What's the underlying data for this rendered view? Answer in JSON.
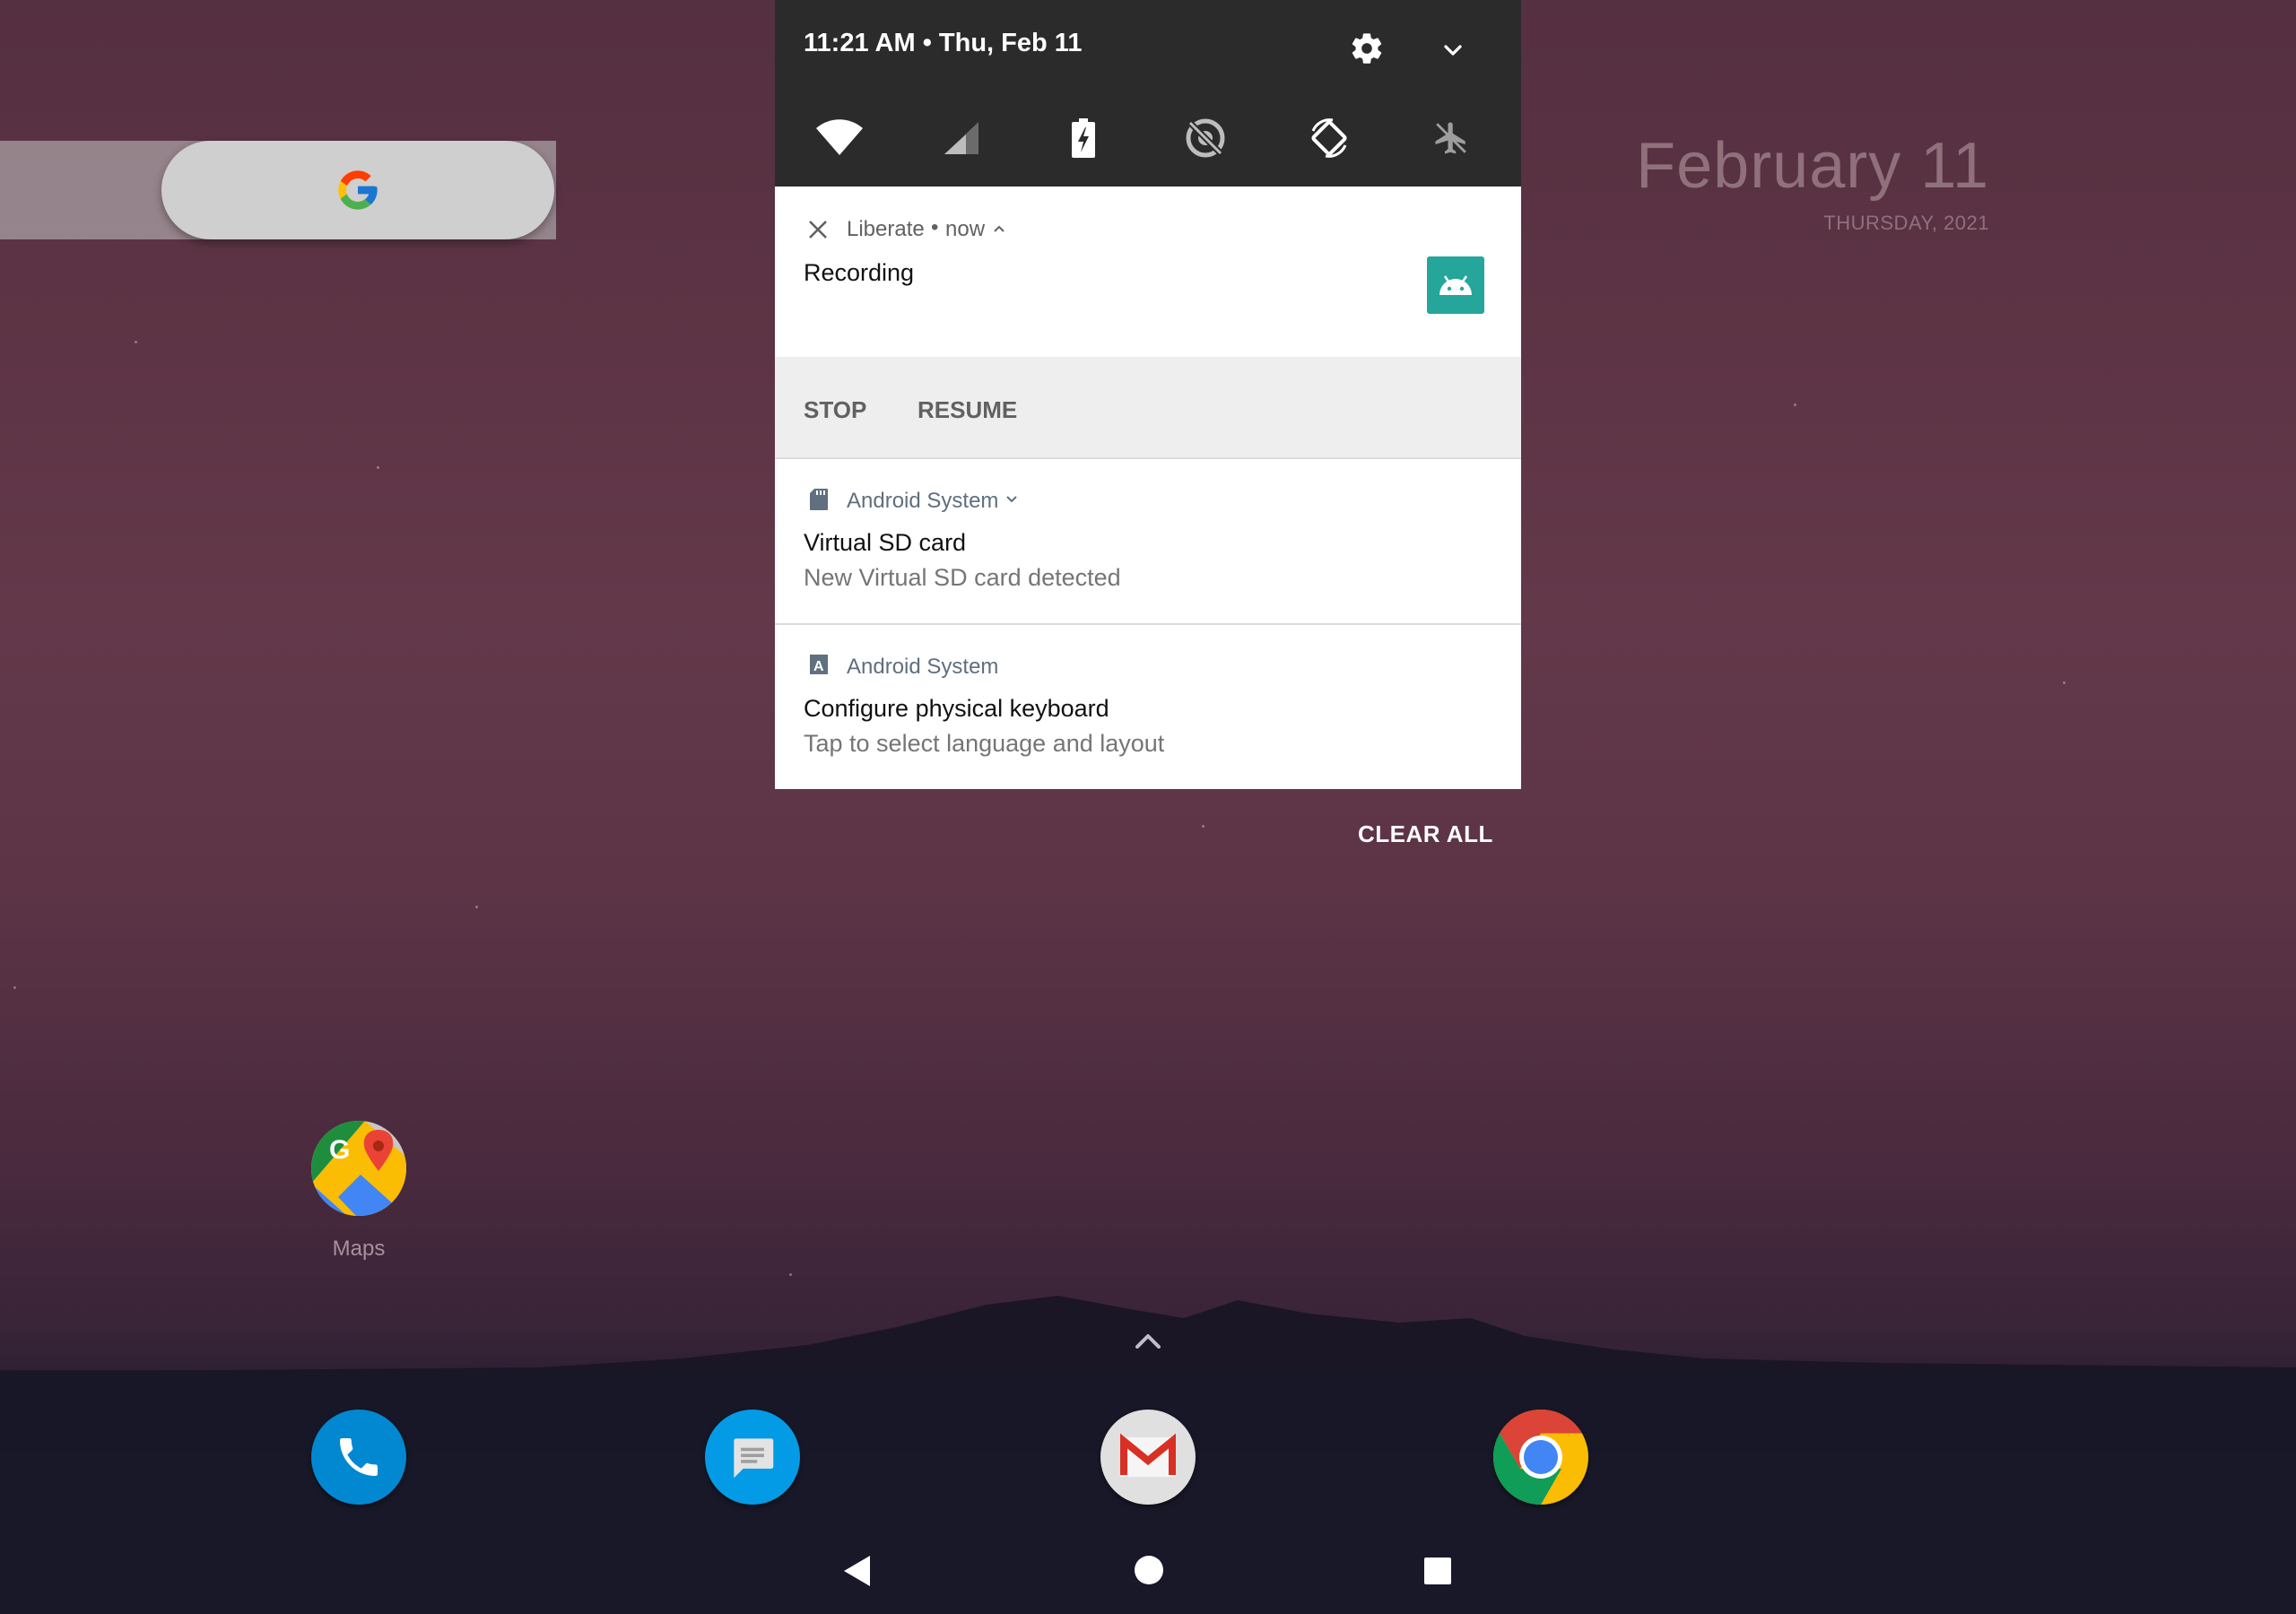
{
  "homescreen": {
    "date_widget": {
      "date": "February 11",
      "weekday_year": "THURSDAY, 2021"
    },
    "apps": [
      {
        "label": "Maps",
        "icon": "maps-icon"
      }
    ],
    "dock": [
      {
        "icon": "phone-icon"
      },
      {
        "icon": "messages-icon"
      },
      {
        "icon": "gmail-icon"
      },
      {
        "icon": "chrome-icon"
      }
    ]
  },
  "quick_settings": {
    "time_date": "11:21 AM • Thu, Feb 11",
    "tiles": [
      "wifi-icon",
      "cellular-signal-icon",
      "battery-charging-icon",
      "data-saver-icon",
      "auto-rotate-icon",
      "airplane-mode-icon"
    ]
  },
  "notifications": [
    {
      "app": "Liberate",
      "time": "now",
      "title": "Recording",
      "actions": [
        "STOP",
        "RESUME"
      ]
    },
    {
      "app": "Android System",
      "title": "Virtual SD card",
      "text": "New Virtual SD card detected"
    },
    {
      "app": "Android System",
      "title": "Configure physical keyboard",
      "text": "Tap to select language and layout"
    }
  ],
  "clear_all": "CLEAR ALL",
  "colors": {
    "shade_header": "#2b2b2b",
    "android_icon_bg": "#26a69a",
    "dock_bg": "#181828"
  }
}
